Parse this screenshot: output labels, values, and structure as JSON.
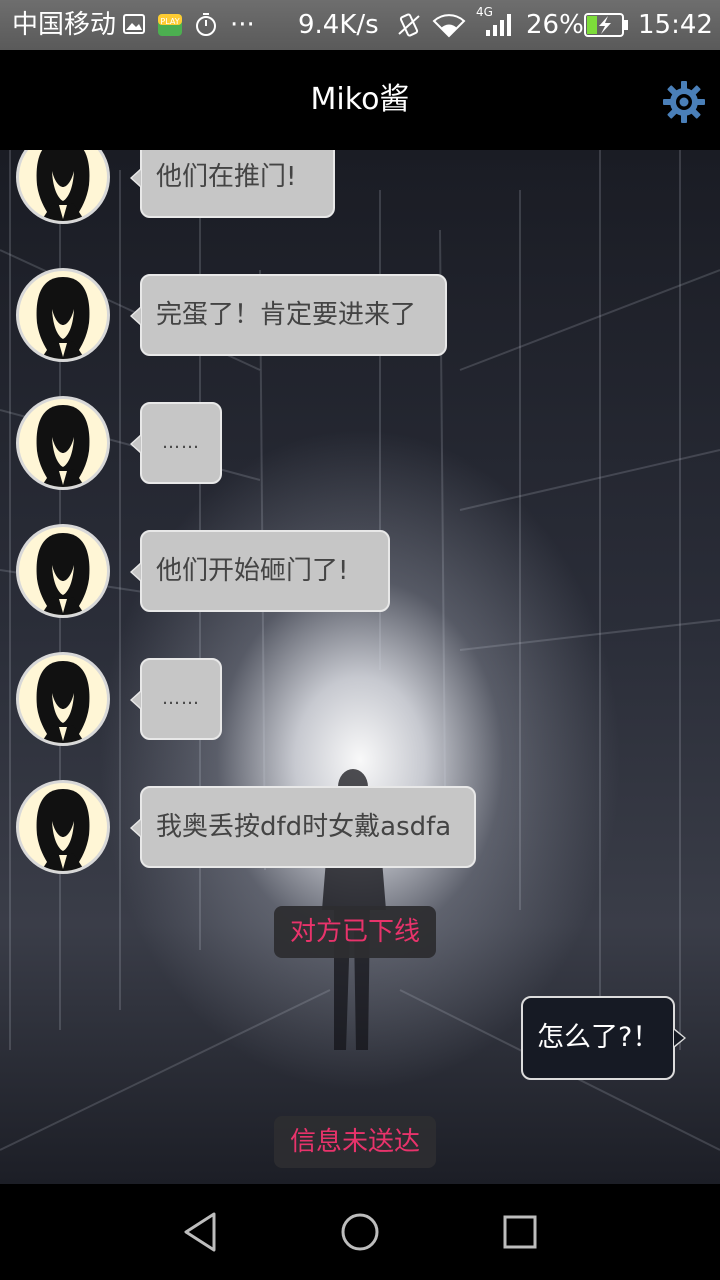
{
  "status_bar": {
    "carrier": "中国移动",
    "more": "···",
    "speed": "9.4K/s",
    "network": "4G",
    "battery": "26%",
    "time": "15:42",
    "icons": [
      "image-icon",
      "play-icon",
      "timer-icon",
      "vibrate-icon",
      "wifi-icon",
      "signal-icon",
      "battery-charging-icon"
    ]
  },
  "header": {
    "title": "Miko酱",
    "settings_icon": "gear-icon"
  },
  "messages": [
    {
      "text": "他们在推门!"
    },
    {
      "text": "完蛋了！肯定要进来了"
    },
    {
      "text": "……"
    },
    {
      "text": "他们开始砸门了!"
    },
    {
      "text": "……"
    },
    {
      "text": "我奥丢按dfd时女戴asdfa"
    }
  ],
  "system_notice_1": "对方已下线",
  "outgoing_message": "怎么了?！",
  "system_notice_2": "信息未送达",
  "nav": {
    "icons": [
      "back-icon",
      "home-icon",
      "recents-icon"
    ]
  },
  "colors": {
    "accent_red": "#e8336b",
    "bubble_incoming": "#c6c6c6",
    "bubble_outgoing": "#161a24",
    "gear_blue": "#4a7fb8"
  }
}
